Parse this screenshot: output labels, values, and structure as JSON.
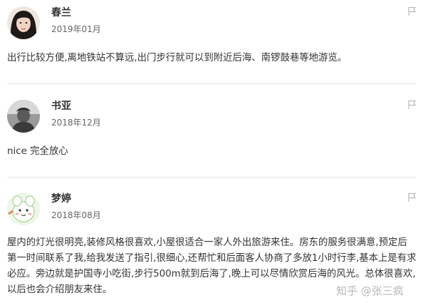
{
  "reviews": [
    {
      "name": "春兰",
      "date": "2019年01月",
      "text": "出行比较方便,离地铁站不算远,出门步行就可以到附近后海、南锣鼓巷等地游览。",
      "avatar": "photo-avatar-woman"
    },
    {
      "name": "书亚",
      "date": "2018年12月",
      "text": "nice 完全放心",
      "avatar": "photo-avatar-man"
    },
    {
      "name": "梦婷",
      "date": "2018年08月",
      "text": "屋内的灯光很明亮,装修风格很喜欢,小屋很适合一家人外出旅游来住。房东的服务很满意,预定后第一时间联系了我,给我发送了指引,很细心,还帮忙和后面客人协商了多放1小时行李,基本上是有求必应。旁边就是护国寺小吃街,步行500m就到后海了,晚上可以尽情欣赏后海的风光。总体很喜欢,以后也会介绍朋友来住。",
      "avatar": "cartoon-avatar"
    }
  ],
  "watermark": "知乎 @张三疯",
  "colors": {
    "text": "#333333",
    "muted": "#666666",
    "divider": "#e5e5e5",
    "icon": "#bbbbbb"
  }
}
